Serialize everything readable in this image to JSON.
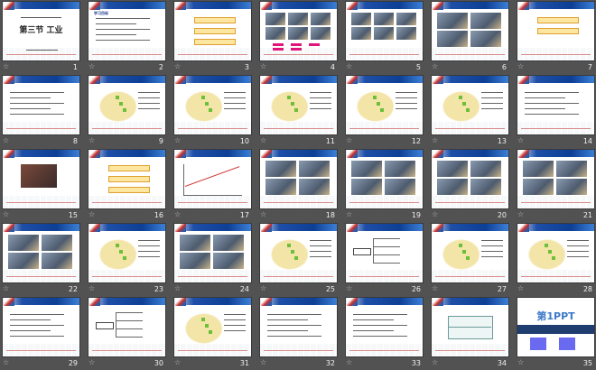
{
  "slides": [
    {
      "n": "1",
      "kind": "title",
      "title": "第三节 工业"
    },
    {
      "n": "2",
      "kind": "text",
      "title": "学习目标"
    },
    {
      "n": "3",
      "kind": "boxes"
    },
    {
      "n": "4",
      "kind": "photos6pink"
    },
    {
      "n": "5",
      "kind": "photos6"
    },
    {
      "n": "6",
      "kind": "photos4"
    },
    {
      "n": "7",
      "kind": "boxes2"
    },
    {
      "n": "8",
      "kind": "text"
    },
    {
      "n": "9",
      "kind": "map"
    },
    {
      "n": "10",
      "kind": "map"
    },
    {
      "n": "11",
      "kind": "map"
    },
    {
      "n": "12",
      "kind": "map"
    },
    {
      "n": "13",
      "kind": "map"
    },
    {
      "n": "14",
      "kind": "text"
    },
    {
      "n": "15",
      "kind": "photo1"
    },
    {
      "n": "16",
      "kind": "boxes"
    },
    {
      "n": "17",
      "kind": "chart"
    },
    {
      "n": "18",
      "kind": "photos4"
    },
    {
      "n": "19",
      "kind": "photos4"
    },
    {
      "n": "20",
      "kind": "photos4"
    },
    {
      "n": "21",
      "kind": "photos4"
    },
    {
      "n": "22",
      "kind": "photos4"
    },
    {
      "n": "23",
      "kind": "map"
    },
    {
      "n": "24",
      "kind": "photos4"
    },
    {
      "n": "25",
      "kind": "map"
    },
    {
      "n": "26",
      "kind": "diagram"
    },
    {
      "n": "27",
      "kind": "map"
    },
    {
      "n": "28",
      "kind": "map"
    },
    {
      "n": "29",
      "kind": "text"
    },
    {
      "n": "30",
      "kind": "diagram"
    },
    {
      "n": "31",
      "kind": "map"
    },
    {
      "n": "32",
      "kind": "text"
    },
    {
      "n": "33",
      "kind": "text"
    },
    {
      "n": "34",
      "kind": "table"
    },
    {
      "n": "35",
      "kind": "ppt",
      "title": "第1PPT"
    }
  ],
  "star_icon": "☆"
}
